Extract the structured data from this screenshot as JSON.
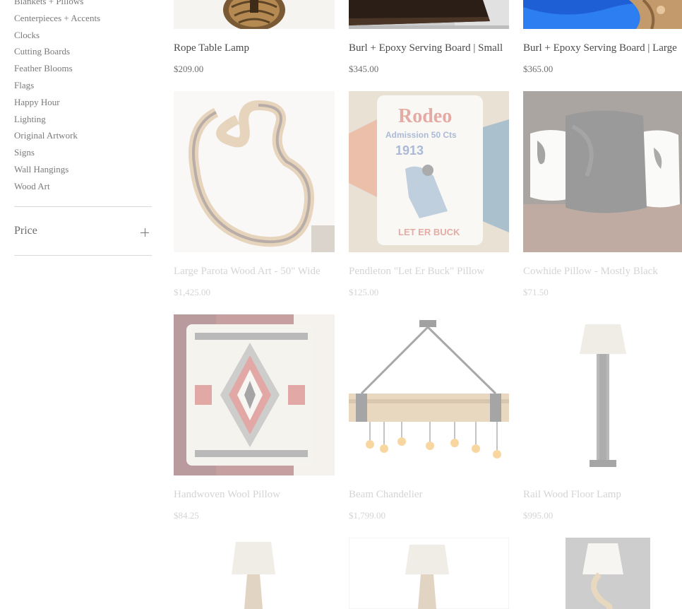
{
  "sidebar": {
    "categories": [
      "Blankets + Pillows",
      "Centerpieces + Accents",
      "Clocks",
      "Cutting Boards",
      "Feather Blooms",
      "Flags",
      "Happy Hour",
      "Lighting",
      "Original Artwork",
      "Signs",
      "Wall Hangings",
      "Wood Art"
    ],
    "price_filter_label": "Price"
  },
  "products": [
    {
      "name": "Rope Table Lamp",
      "price": "$209.00"
    },
    {
      "name": "Burl + Epoxy Serving Board | Small",
      "price": "$345.00"
    },
    {
      "name": "Burl + Epoxy Serving Board | Large",
      "price": "$365.00"
    },
    {
      "name": "Large Parota Wood Art - 50\" Wide",
      "price": "$1,425.00"
    },
    {
      "name": "Pendleton \"Let Er Buck\" Pillow",
      "price": "$125.00"
    },
    {
      "name": "Cowhide Pillow - Mostly Black",
      "price": "$71.50"
    },
    {
      "name": "Handwoven Wool Pillow",
      "price": "$84.25"
    },
    {
      "name": "Beam Chandelier",
      "price": "$1,799.00"
    },
    {
      "name": "Rail Wood Floor Lamp",
      "price": "$995.00"
    }
  ],
  "pillow_text": {
    "line1": "Rodeo",
    "line2": "Admission 50 Cts",
    "line3": "1913",
    "line4": "LET ER BUCK"
  },
  "colors": {
    "text": "#6b6b6b",
    "divider": "#d9d9d9",
    "epoxy_blue": "#1e5fd6"
  }
}
